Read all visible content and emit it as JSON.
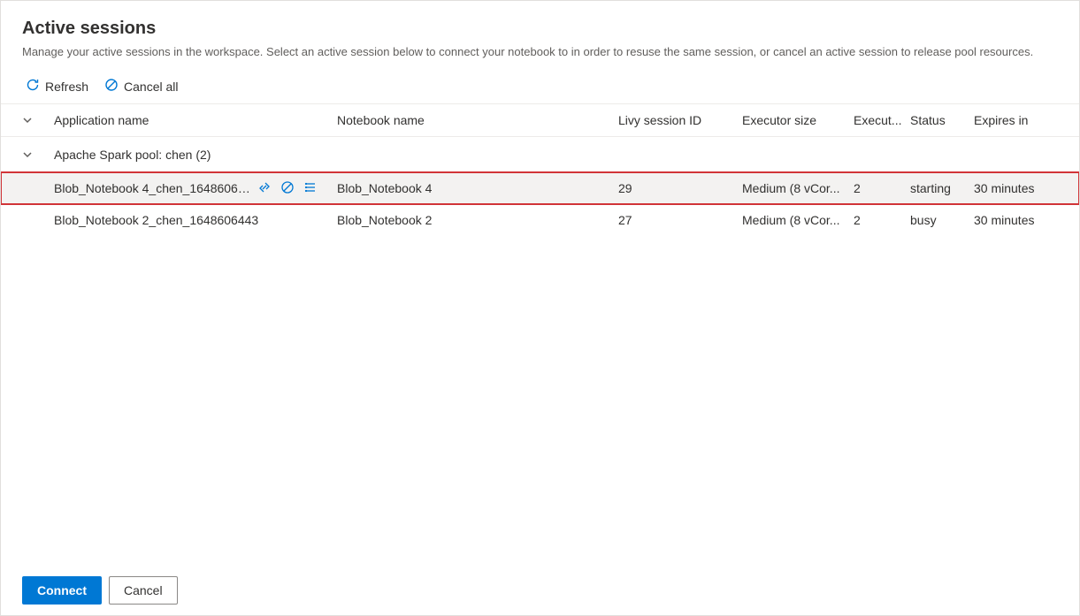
{
  "title": "Active sessions",
  "subtitle": "Manage your active sessions in the workspace. Select an active session below to connect your notebook to in order to resuse the same session, or cancel an active session to release pool resources.",
  "toolbar": {
    "refresh": "Refresh",
    "cancel_all": "Cancel all"
  },
  "columns": {
    "app_name": "Application name",
    "notebook_name": "Notebook name",
    "livy": "Livy session ID",
    "exec_size": "Executor size",
    "exec_count": "Execut...",
    "status": "Status",
    "expires": "Expires in"
  },
  "group": {
    "label": "Apache Spark pool: chen (2)"
  },
  "rows": [
    {
      "app_name": "Blob_Notebook 4_chen_16486065...",
      "notebook_name": "Blob_Notebook 4",
      "livy": "29",
      "exec_size": "Medium (8 vCor...",
      "exec_count": "2",
      "status": "starting",
      "expires": "30 minutes",
      "selected": true
    },
    {
      "app_name": "Blob_Notebook 2_chen_1648606443",
      "notebook_name": "Blob_Notebook 2",
      "livy": "27",
      "exec_size": "Medium (8 vCor...",
      "exec_count": "2",
      "status": "busy",
      "expires": "30 minutes",
      "selected": false
    }
  ],
  "footer": {
    "connect": "Connect",
    "cancel": "Cancel"
  }
}
